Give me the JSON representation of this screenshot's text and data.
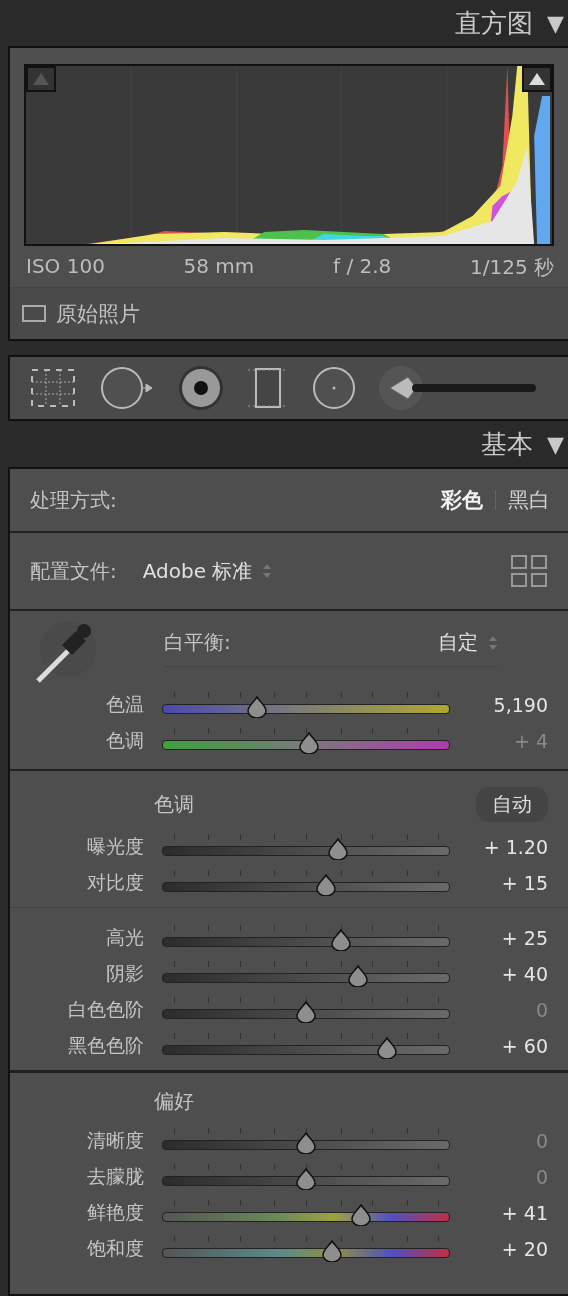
{
  "histogram": {
    "title": "直方图",
    "collapse_icon": "▼",
    "info": [
      "ISO 100",
      "58 mm",
      "f / 2.8",
      "1/125 秒"
    ],
    "original_photo": {
      "label": "原始照片",
      "checked": false
    }
  },
  "basic": {
    "title": "基本",
    "collapse_icon": "▼",
    "treatment": {
      "label": "处理方式:",
      "options": [
        {
          "label": "彩色",
          "selected": true
        },
        {
          "label": "黑白",
          "selected": false
        }
      ]
    },
    "profile": {
      "label": "配置文件:",
      "value": "Adobe 标准"
    },
    "white_balance": {
      "label": "白平衡:",
      "value": "自定",
      "sliders": [
        {
          "label": "色温",
          "kind": "temp",
          "level": 0.33,
          "value": "5,190",
          "dimmed": false
        },
        {
          "label": "色调",
          "kind": "tint",
          "level": 0.51,
          "value": "+ 4",
          "dimmed": true
        }
      ]
    },
    "tone": {
      "title": "色调",
      "auto": "自动",
      "groups": [
        [
          {
            "label": "曝光度",
            "kind": "plain",
            "level": 0.61,
            "value": "+ 1.20",
            "dimmed": false
          },
          {
            "label": "对比度",
            "kind": "plain",
            "level": 0.57,
            "value": "+ 15",
            "dimmed": false
          }
        ],
        [
          {
            "label": "高光",
            "kind": "plain",
            "level": 0.62,
            "value": "+ 25",
            "dimmed": false
          },
          {
            "label": "阴影",
            "kind": "plain",
            "level": 0.68,
            "value": "+ 40",
            "dimmed": false
          },
          {
            "label": "白色色阶",
            "kind": "plain",
            "level": 0.5,
            "value": "0",
            "dimmed": true
          },
          {
            "label": "黑色色阶",
            "kind": "plain",
            "level": 0.78,
            "value": "+ 60",
            "dimmed": false
          }
        ]
      ]
    },
    "presence": {
      "title": "偏好",
      "sliders": [
        {
          "label": "清晰度",
          "kind": "plain",
          "level": 0.5,
          "value": "0",
          "dimmed": true
        },
        {
          "label": "去朦胧",
          "kind": "plain",
          "level": 0.5,
          "value": "0",
          "dimmed": true
        },
        {
          "label": "鲜艳度",
          "kind": "vibrance",
          "level": 0.69,
          "value": "+ 41",
          "dimmed": false
        },
        {
          "label": "饱和度",
          "kind": "saturation",
          "level": 0.59,
          "value": "+ 20",
          "dimmed": false
        }
      ]
    }
  }
}
